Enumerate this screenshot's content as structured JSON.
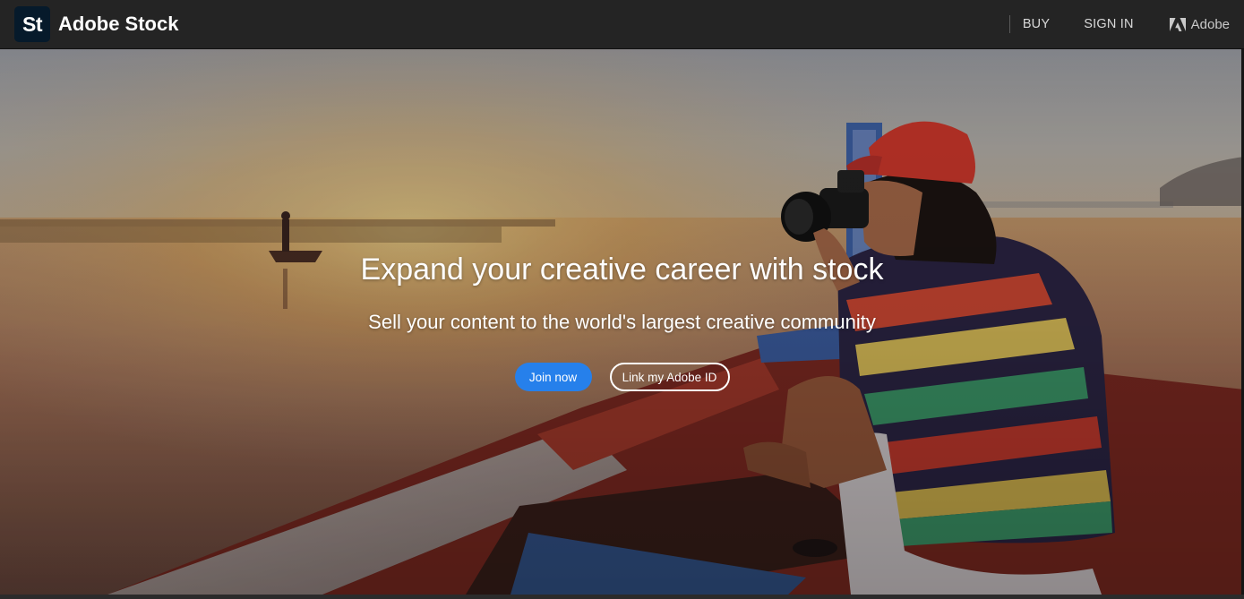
{
  "header": {
    "logo_text": "St",
    "brand": "Adobe Stock",
    "nav": {
      "buy": "BUY",
      "sign_in": "SIGN IN",
      "adobe": "Adobe"
    }
  },
  "hero": {
    "headline": "Expand your creative career with stock",
    "subhead": "Sell your content to the world's largest creative community",
    "primary_button": "Join now",
    "secondary_button": "Link my Adobe ID"
  },
  "colors": {
    "topbar": "#242424",
    "logo_bg": "#061a2b",
    "primary_button": "#2680eb"
  },
  "icons": [
    "adobe-logo-icon"
  ]
}
